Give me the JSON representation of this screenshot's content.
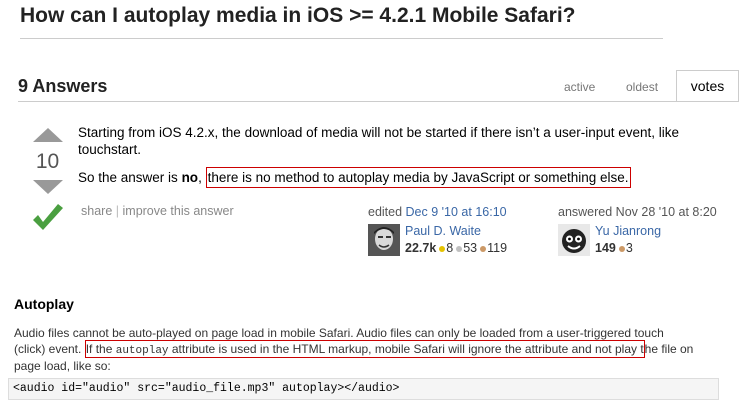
{
  "question": {
    "title": "How can I autoplay media in iOS >= 4.2.1 Mobile Safari?"
  },
  "answers_header": {
    "count_label": "9 Answers",
    "tabs": [
      "active",
      "oldest",
      "votes"
    ]
  },
  "answer": {
    "vote_count": "10",
    "accepted": true,
    "p1": "Starting from iOS 4.2.x, the download of media will not be started if there isn’t a user-input event, like touchstart.",
    "p2_prefix": "So the answer is ",
    "p2_bold": "no",
    "p2_comma": ", ",
    "p2_highlight": "there is no method to autoplay media by JavaScript or something else.",
    "links": {
      "share": "share",
      "separator": "|",
      "improve": "improve this answer"
    },
    "edited": {
      "label": "edited ",
      "when": "Dec 9 '10 at 16:10",
      "user": "Paul D. Waite",
      "reputation": "22.7k",
      "gold": "8",
      "silver": "53",
      "bronze": "119"
    },
    "answered": {
      "label": "answered Nov 28 '10 at 8:20",
      "user": "Yu Jianrong",
      "reputation": "149",
      "bronze": "3"
    }
  },
  "excerpt": {
    "heading": "Autoplay",
    "line1": "Audio files cannot be auto-played on page load in mobile Safari. Audio files can only be loaded from a user-triggered touch",
    "line2_prefix": "(click) event. ",
    "line2_hl_a": "If the ",
    "line2_code": "autoplay",
    "line2_hl_b": " attribute is used in the HTML markup, mobile Safari will ignore the attribute and not play t",
    "line2_suffix": "he file on",
    "line3": "page load, like so:",
    "code": "<audio id=\"audio\" src=\"audio_file.mp3\" autoplay></audio>"
  },
  "colors": {
    "link": "#3a67a6",
    "highlight_border": "#cc0000",
    "accepted_check": "#4a9f40",
    "gold": "#e6c300",
    "silver": "#c0c0c0",
    "bronze": "#cc9966"
  }
}
